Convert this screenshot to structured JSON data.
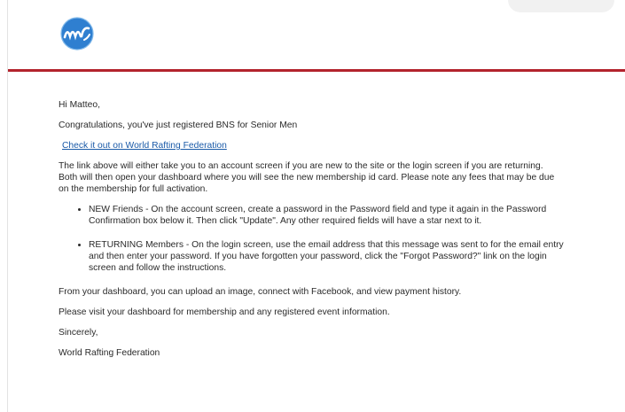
{
  "email": {
    "greeting": "Hi Matteo,",
    "congrats": "Congratulations, you've just registered BNS for Senior Men",
    "link_text": "Check it out on World Rafting Federation",
    "para_link_info": "The link above will either take you to an account screen if you are new to the site or the login screen if you are returning. Both will then open your dashboard where you will see the new membership id card. Please note any fees that may be due on the membership for full activation.",
    "bullets": [
      "NEW Friends - On the account screen, create a password in the Password field and type it again in the Password Confirmation box below it. Then click \"Update\". Any other required fields will have a star next to it.",
      "RETURNING Members - On the login screen, use the email address that this message was sent to for the email entry and then enter your password. If you have forgotten your password, click the \"Forgot Password?\" link on the login screen and follow the instructions."
    ],
    "para_dashboard": "From your dashboard, you can upload an image, connect with Facebook, and view payment history.",
    "para_visit": "Please visit your dashboard for membership and any registered event information.",
    "signoff": "Sincerely,",
    "signature": "World Rafting Federation"
  },
  "colors": {
    "accent_rule": "#b3232d",
    "logo_blue": "#2f7fd0",
    "link": "#1a5aa8"
  },
  "icons": {
    "logo": "wrf-logo-icon"
  }
}
